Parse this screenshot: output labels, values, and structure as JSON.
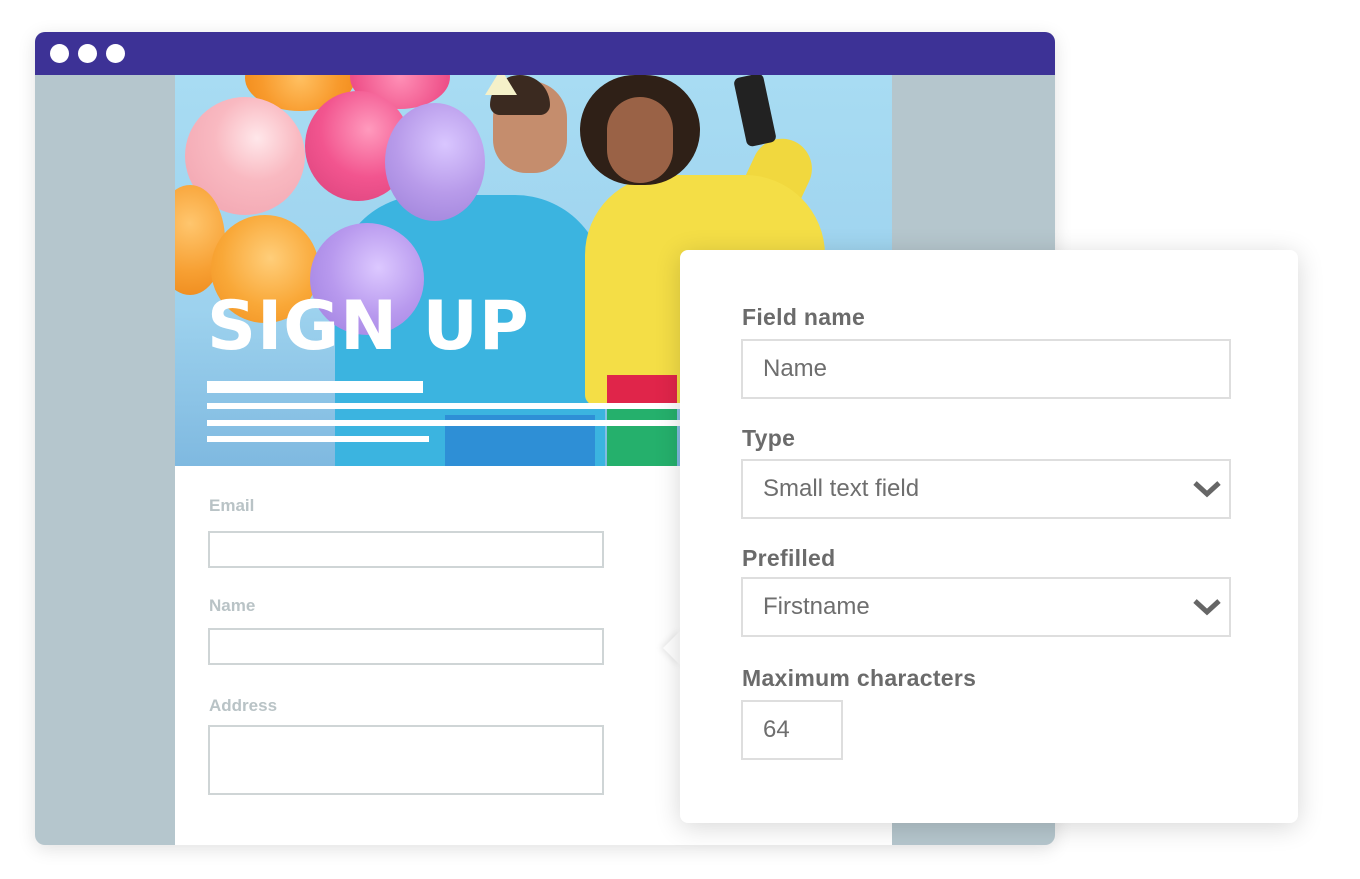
{
  "window": {
    "title_bar_color": "#3d3296",
    "dots": [
      "window-dot",
      "window-dot",
      "window-dot"
    ]
  },
  "hero": {
    "title": "SIGN UP"
  },
  "form": {
    "fields": [
      {
        "label": "Email",
        "value": ""
      },
      {
        "label": "Name",
        "value": ""
      },
      {
        "label": "Address",
        "value": ""
      }
    ]
  },
  "field_settings": {
    "field_name": {
      "label": "Field name",
      "value": "Name"
    },
    "type": {
      "label": "Type",
      "value": "Small text field",
      "icon": "chevron-down-icon"
    },
    "prefilled": {
      "label": "Prefilled",
      "value": "Firstname",
      "icon": "chevron-down-icon"
    },
    "max_chars": {
      "label": "Maximum characters",
      "value": "64"
    }
  },
  "colors": {
    "accent": "#3d3296",
    "sidebar": "#b5c6cd",
    "label_gray": "#6b6b6b",
    "form_label": "#b9c3c6"
  }
}
